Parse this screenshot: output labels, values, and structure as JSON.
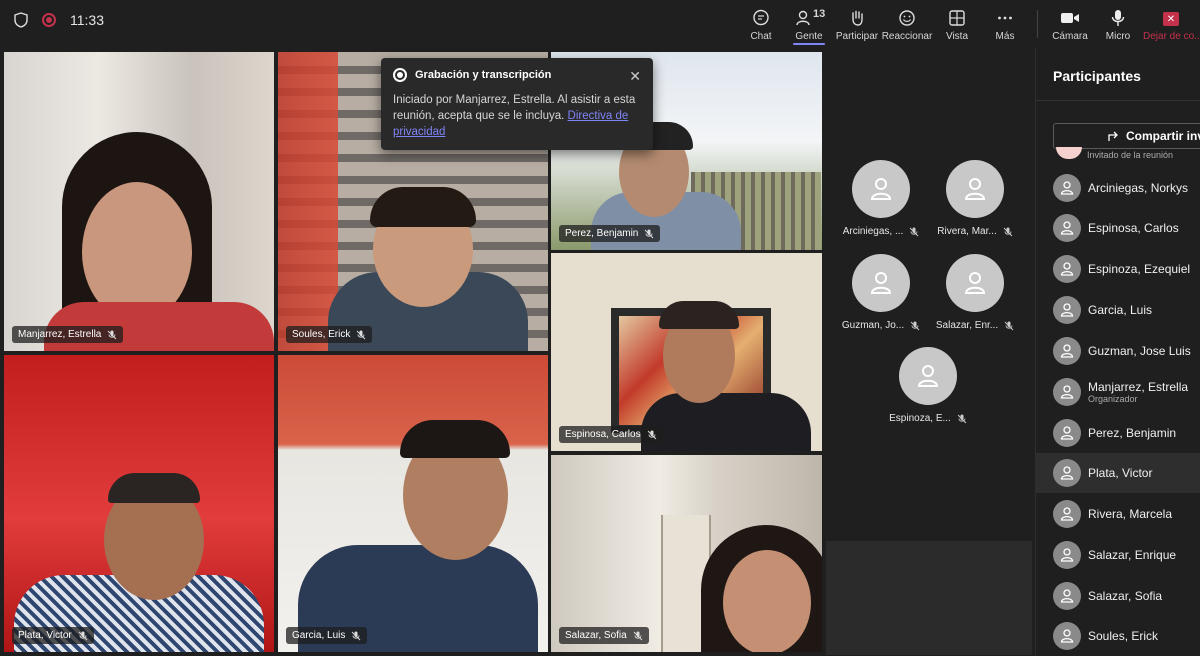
{
  "topbar": {
    "time": "11:33",
    "items": [
      {
        "label": "Chat",
        "icon": "chat-icon"
      },
      {
        "label": "Gente",
        "icon": "people-icon",
        "count": "13"
      },
      {
        "label": "Participar",
        "icon": "hand-icon"
      },
      {
        "label": "Reaccionar",
        "icon": "smile-icon"
      },
      {
        "label": "Vista",
        "icon": "grid-icon"
      },
      {
        "label": "Más",
        "icon": "more-icon"
      },
      {
        "label": "Cámara",
        "icon": "camera-icon"
      },
      {
        "label": "Micro",
        "icon": "mic-icon"
      },
      {
        "label": "Dejar de co...",
        "icon": "leave-icon"
      }
    ]
  },
  "popup": {
    "title": "Grabación y transcripción",
    "body": "Iniciado por Manjarrez, Estrella. Al asistir a esta reunión, acepta que se le incluya.",
    "link": "Directiva de privacidad"
  },
  "tiles": [
    {
      "name": "Manjarrez, Estrella"
    },
    {
      "name": "Soules, Erick"
    },
    {
      "name": "Perez, Benjamin"
    },
    {
      "name": "Espinosa, Carlos"
    },
    {
      "name": "Plata, Victor"
    },
    {
      "name": "Garcia, Luis"
    },
    {
      "name": "Salazar, Sofia"
    }
  ],
  "avatars": [
    {
      "name": "Arciniegas, ..."
    },
    {
      "name": "Rivera, Mar..."
    },
    {
      "name": "Guzman, Jo..."
    },
    {
      "name": "Salazar, Enr..."
    },
    {
      "name": "Espinoza, E..."
    }
  ],
  "panel": {
    "title": "Participantes",
    "share": "Compartir inv",
    "guest": "Invitado de la reunión",
    "participants": [
      {
        "name": "Arciniegas, Norkys",
        "role": ""
      },
      {
        "name": "Espinosa, Carlos",
        "role": ""
      },
      {
        "name": "Espinoza, Ezequiel",
        "role": ""
      },
      {
        "name": "Garcia, Luis",
        "role": ""
      },
      {
        "name": "Guzman, Jose Luis",
        "role": ""
      },
      {
        "name": "Manjarrez, Estrella",
        "role": "Organizador"
      },
      {
        "name": "Perez, Benjamin",
        "role": ""
      },
      {
        "name": "Plata, Victor",
        "role": ""
      },
      {
        "name": "Rivera, Marcela",
        "role": ""
      },
      {
        "name": "Salazar, Enrique",
        "role": ""
      },
      {
        "name": "Salazar, Sofia",
        "role": ""
      },
      {
        "name": "Soules, Erick",
        "role": ""
      }
    ]
  }
}
